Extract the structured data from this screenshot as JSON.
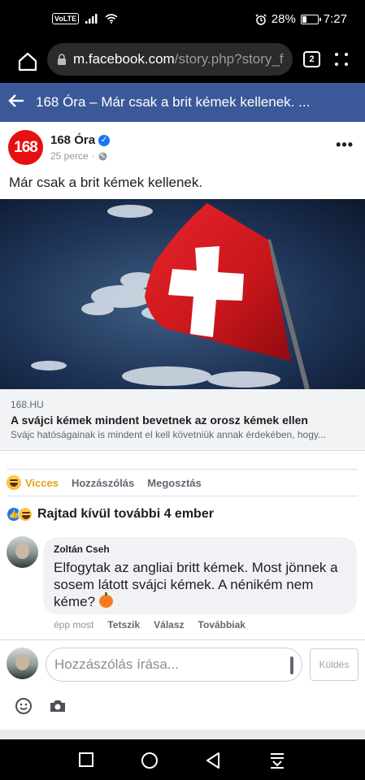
{
  "status_bar": {
    "network": "VoLTE",
    "battery_percent": "28%",
    "battery_level": 0.28,
    "time": "7:27"
  },
  "browser": {
    "url_host": "m.facebook.com",
    "url_path": "/story.php?story_f",
    "tab_count": "2"
  },
  "header": {
    "title": "168 Óra – Már csak a brit kémek kellenek. ..."
  },
  "post": {
    "page_logo_text": "168",
    "page_name": "168 Óra",
    "time_ago": "25 perce",
    "separator": "·",
    "text": "Már csak a brit kémek kellenek.",
    "link": {
      "domain": "168.HU",
      "title": "A svájci kémek mindent bevetnek az orosz kémek ellen",
      "description": "Svájc hatóságainak is mindent el kell követniük annak érdekében, hogy..."
    },
    "actions": {
      "reaction_label": "Vicces",
      "comment_label": "Hozzászólás",
      "share_label": "Megosztás"
    },
    "reaction_summary": "Rajtad kívül további 4 ember"
  },
  "comment": {
    "author": "Zoltán Cseh",
    "text": "Elfogytak az angliai britt kémek. Most jönnek a sosem látott svájci kémek. A nénikém nem kéme?",
    "time": "épp most",
    "like_label": "Tetszik",
    "reply_label": "Válasz",
    "more_label": "Továbbiak"
  },
  "composer": {
    "placeholder": "Hozzászólás írása...",
    "send_label": "Küldés"
  },
  "colors": {
    "fb_blue": "#3b5998",
    "brand_red": "#e60f12",
    "link_blue": "#1877f2"
  }
}
